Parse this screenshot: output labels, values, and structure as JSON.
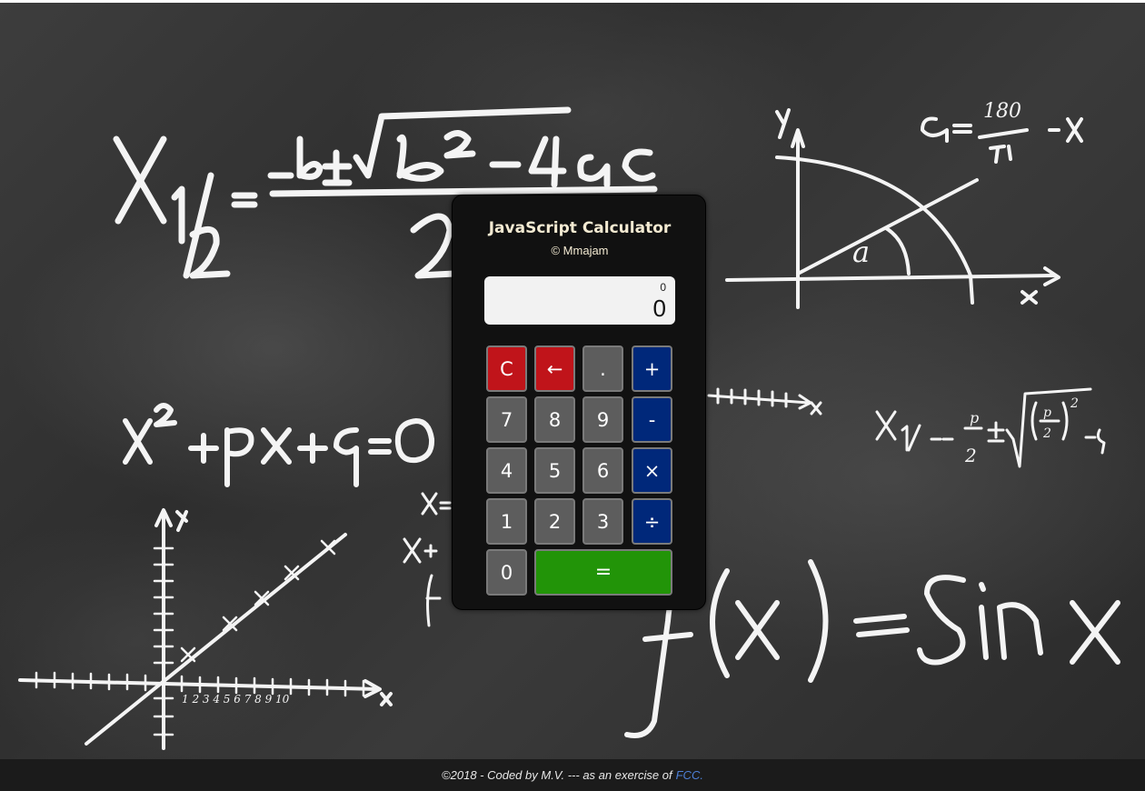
{
  "calculator": {
    "title": "JavaScript Calculator",
    "author": "© Mmajam",
    "display": {
      "formula": "0",
      "value": "0"
    },
    "buttons": {
      "clear": "C",
      "backspace": "←",
      "decimal": ".",
      "add": "+",
      "seven": "7",
      "eight": "8",
      "nine": "9",
      "subtract": "-",
      "four": "4",
      "five": "5",
      "six": "6",
      "multiply": "×",
      "one": "1",
      "two": "2",
      "three": "3",
      "divide": "÷",
      "zero": "0",
      "equals": "="
    },
    "colors": {
      "clear": "#c0141a",
      "operator": "#00287a",
      "equals": "#229408",
      "number": "#5d5d5d"
    }
  },
  "footer": {
    "text": "©2018 - Coded by M.V. --- as an exercise of",
    "link": "FCC."
  }
}
